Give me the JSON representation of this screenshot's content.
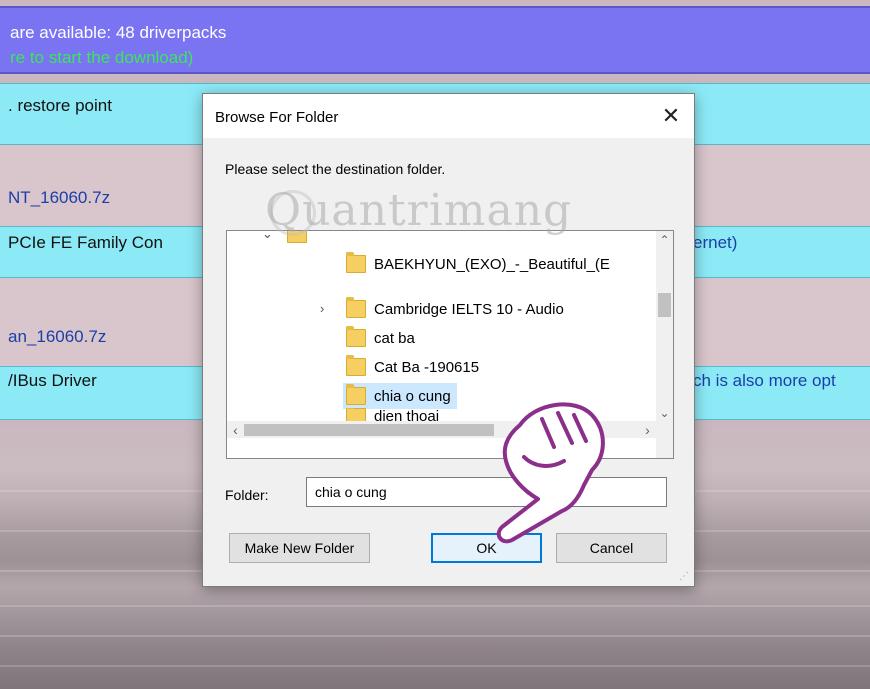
{
  "app": {
    "available_text": "are available: 48 driverpacks",
    "download_text": "re to start the download)",
    "rows": [
      {
        "text": ". restore point"
      },
      {
        "text": "NT_16060.7z"
      },
      {
        "text": "PCIe FE Family Con",
        "right_text": "ernet)"
      },
      {
        "text": "an_16060.7z"
      },
      {
        "text": "/IBus Driver",
        "right_text": "ch is also more opt"
      }
    ]
  },
  "dialog": {
    "title": "Browse For Folder",
    "close_glyph": "✕",
    "instruction": "Please select the destination folder.",
    "tree_items": [
      {
        "label": "BAEKHYUN_(EXO)_-_Beautiful_(E",
        "expandable": false,
        "selected": false
      },
      {
        "label": "Cambridge IELTS 10 - Audio",
        "expandable": true,
        "selected": false
      },
      {
        "label": "cat ba",
        "expandable": false,
        "selected": false
      },
      {
        "label": "Cat Ba -190615",
        "expandable": false,
        "selected": false
      },
      {
        "label": "chia o cung",
        "expandable": false,
        "selected": true
      },
      {
        "label": "dien thoai",
        "expandable": false,
        "selected": false
      }
    ],
    "folder_label": "Folder:",
    "folder_value": "chia o cung",
    "buttons": {
      "make_new_folder": "Make New Folder",
      "ok": "OK",
      "cancel": "Cancel"
    }
  },
  "watermark": "Quantrimang",
  "colors": {
    "header_band": "#7a74f2",
    "download_text": "#3ae65a",
    "cyan_band": "#8ceaf7",
    "selection": "#cce8ff",
    "ok_border": "#0078d7"
  }
}
